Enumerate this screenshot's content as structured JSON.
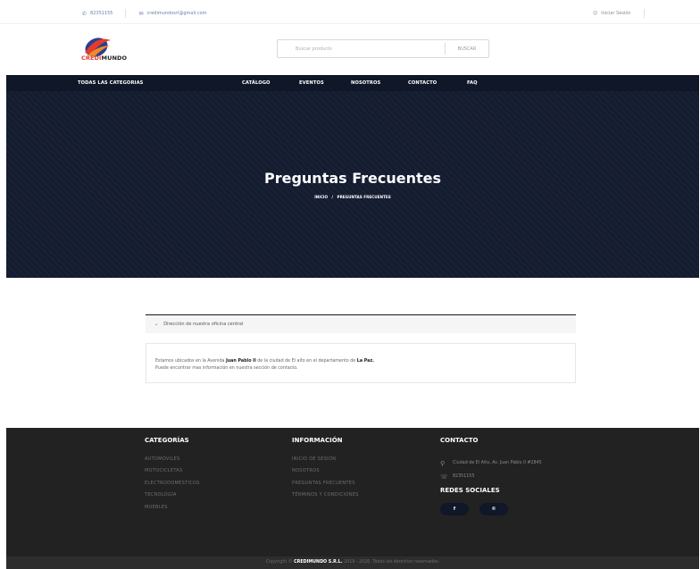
{
  "topbar": {
    "phone": "82351155",
    "email": "credimundosrl@gmail.com",
    "login": "Iniciar Sesión"
  },
  "logo": {
    "part1": "CREDI",
    "part2": "MUNDO",
    "colors": {
      "red": "#e53b2c",
      "blue": "#2a3f8f",
      "orange": "#f08a24",
      "dark": "#222222"
    }
  },
  "search": {
    "placeholder": "Buscar producto",
    "button": "BUSCAR"
  },
  "nav": {
    "items": [
      "TODAS LAS CATEGORIAS",
      "CATÁLOGO",
      "EVENTOS",
      "NOSOTROS",
      "CONTACTO",
      "FAQ"
    ],
    "background": "#0f1728"
  },
  "hero": {
    "title": "Preguntas Frecuentes",
    "breadcrumb_home": "INICIO",
    "breadcrumb_sep": "/",
    "breadcrumb_current": "PREGUNTAS FRECUENTES"
  },
  "faq": {
    "question": "Dirección de nuestra oficina central",
    "answer_pre": "Estamos ubicados en la Avenida ",
    "answer_bold1": "Juan Pablo II",
    "answer_mid": " de la ciudad de El alto en el departamento de ",
    "answer_bold2": "La Paz.",
    "answer_line2": "Puede encontrar mas información en nuestra sección de contacto."
  },
  "footer": {
    "categorias": {
      "title": "CATEGORÍAS",
      "links": [
        "AUTOMÓVILES",
        "MOTOCICLETAS",
        "ELECTRODOMESTICOS",
        "TECNOLOGÍA",
        "MUEBLES"
      ]
    },
    "informacion": {
      "title": "INFORMACIÓN",
      "links": [
        "INICIO DE SESIÓN",
        "NOSOTROS",
        "PREGUNTAS FRECUENTES",
        "TÉRMINOS Y CONDICIONES"
      ]
    },
    "contacto": {
      "title": "CONTACTO",
      "address": "Ciudad de El Alto, Av. Juan Pablo II #2845",
      "phone": "82351155",
      "social_title": "REDES SOCIALES",
      "social": [
        "f",
        "©"
      ]
    }
  },
  "copyright": {
    "pre": "Copyright © ",
    "brand": "CREDIMUNDO S.R.L.",
    "post": " 2019 - 2020. Todos los derechos reservados."
  }
}
